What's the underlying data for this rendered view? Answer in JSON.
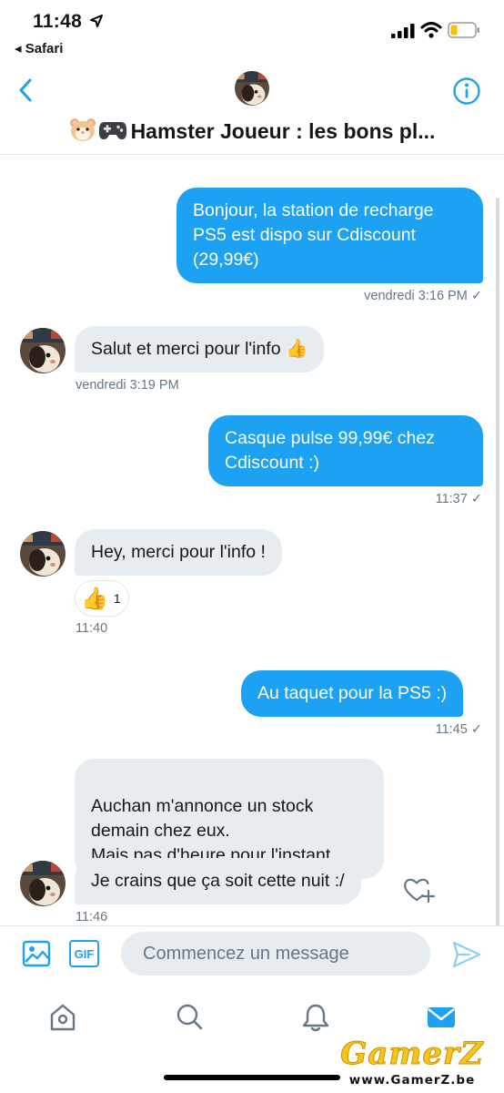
{
  "status_bar": {
    "time": "11:48",
    "back_app": "Safari"
  },
  "conversation": {
    "title": "Hamster Joueur : les bons pl...",
    "title_emoji": [
      "hamster-face-icon",
      "game-controller-icon"
    ]
  },
  "messages": [
    {
      "direction": "sent",
      "text": "Bonjour, la station de recharge PS5 est dispo sur Cdiscount (29,99€)",
      "time": "vendredi 3:16 PM",
      "seen": "✓"
    },
    {
      "direction": "received",
      "text": "Salut et merci pour l'info 👍",
      "time": "vendredi 3:19 PM"
    },
    {
      "direction": "sent",
      "text": "Casque pulse 99,99€ chez Cdiscount :)",
      "time": "11:37",
      "seen": "✓"
    },
    {
      "direction": "received",
      "text": "Hey, merci pour l'info !",
      "reaction": {
        "emoji": "👍",
        "count": "1"
      },
      "time": "11:40"
    },
    {
      "direction": "sent",
      "text": "Au taquet pour la PS5 :)",
      "time": "11:45",
      "seen": "✓"
    },
    {
      "direction": "received",
      "text": "Auchan m'annonce un stock demain chez eux.\nMais pas d'heure pour l'instant."
    },
    {
      "direction": "received",
      "text": "Je crains que ça soit cette nuit :/",
      "time": "11:46"
    }
  ],
  "composer": {
    "placeholder": "Commencez un message",
    "gif_label": "GIF"
  },
  "tabbar": {
    "tabs": [
      "home-icon",
      "search-icon",
      "notifications-icon",
      "messages-icon"
    ],
    "active": "messages-icon"
  },
  "watermark": {
    "logo": "GamerZ",
    "url": "www.GamerZ.be"
  },
  "colors": {
    "accent": "#1da1f2",
    "incoming_bubble": "#e6ecf0",
    "meta_text": "#657786",
    "watermark_gold": "#f5c518"
  }
}
